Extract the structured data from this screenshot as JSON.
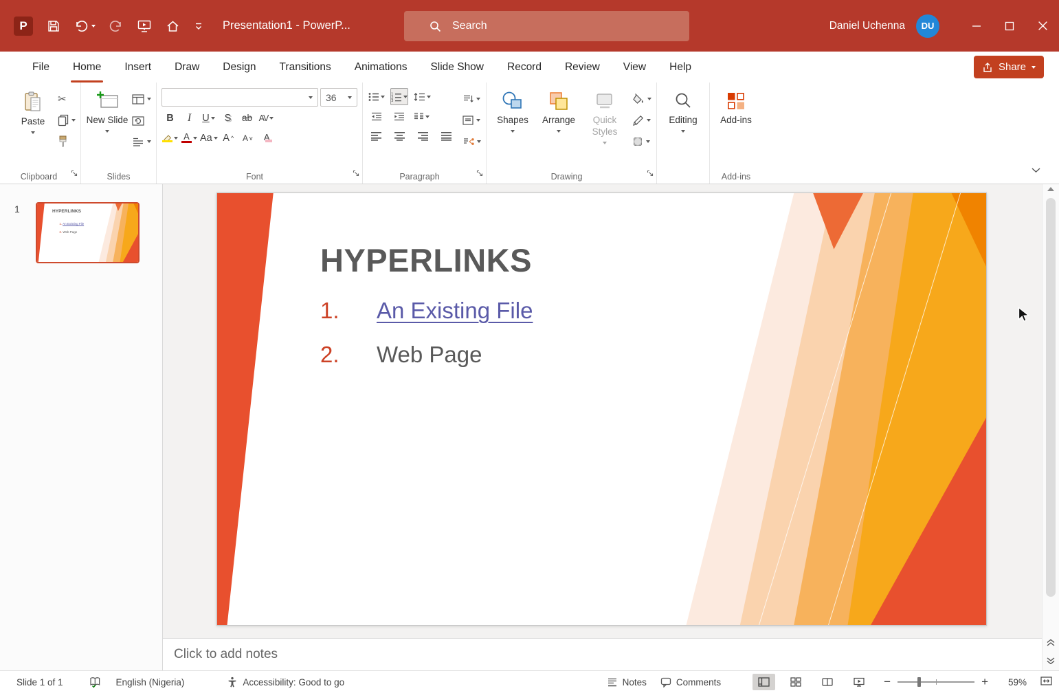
{
  "titlebar": {
    "document_title": "Presentation1  -  PowerP...",
    "search_placeholder": "Search",
    "user_name": "Daniel Uchenna",
    "user_initials": "DU",
    "logo_letter": "P"
  },
  "tabs": [
    "File",
    "Home",
    "Insert",
    "Draw",
    "Design",
    "Transitions",
    "Animations",
    "Slide Show",
    "Record",
    "Review",
    "View",
    "Help"
  ],
  "active_tab": "Home",
  "share": {
    "label": "Share"
  },
  "ribbon": {
    "clipboard": {
      "paste_label": "Paste",
      "group_label": "Clipboard"
    },
    "slides": {
      "new_slide_label": "New Slide",
      "group_label": "Slides"
    },
    "font": {
      "group_label": "Font",
      "font_name_value": "",
      "font_size_value": "36",
      "bold": "B",
      "italic": "I",
      "underline": "U",
      "shadow": "S",
      "strikethrough": "ab",
      "char_spacing": "AV",
      "change_case": "Aa",
      "grow": "A",
      "shrink": "A",
      "clear": "A",
      "color": "A"
    },
    "paragraph": {
      "group_label": "Paragraph"
    },
    "drawing": {
      "group_label": "Drawing",
      "shapes_label": "Shapes",
      "arrange_label": "Arrange",
      "quick_styles_label": "Quick Styles"
    },
    "editing": {
      "label": "Editing"
    },
    "addins": {
      "label": "Add-ins",
      "group_label": "Add-ins"
    }
  },
  "slide_panel": {
    "slide_number": "1"
  },
  "slide": {
    "title": "HYPERLINKS",
    "list_items": [
      {
        "number": "1.",
        "text": "An Existing File",
        "is_link": true
      },
      {
        "number": "2.",
        "text": "Web Page",
        "is_link": false
      }
    ]
  },
  "notes": {
    "placeholder": "Click to add notes"
  },
  "statusbar": {
    "slide_indicator": "Slide 1 of 1",
    "language": "English (Nigeria)",
    "accessibility": "Accessibility: Good to go",
    "notes_label": "Notes",
    "comments_label": "Comments",
    "zoom_level": "59%"
  },
  "colors": {
    "titlebar_bg": "#B5392B",
    "accent_red": "#C2401F",
    "avatar_blue": "#2287D8",
    "slide_orange": "#E8502E",
    "slide_yellow": "#F7A81B",
    "hyperlink": "#5A5AA8",
    "slide_text_gray": "#595959"
  }
}
